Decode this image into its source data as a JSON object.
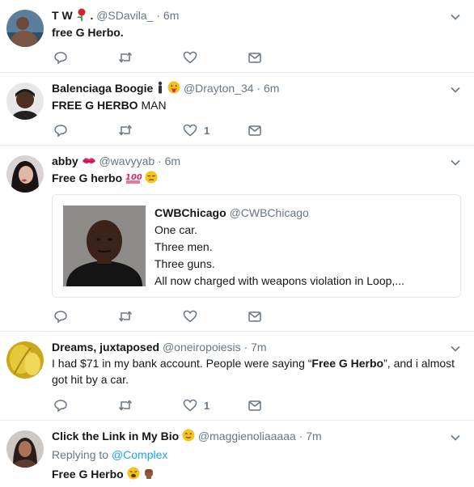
{
  "tweets": [
    {
      "name": "T W",
      "name_suffix": ".",
      "handle": "@SDavila_",
      "time": "6m",
      "text_bold": "free G Herbo.",
      "text_rest": "",
      "like_count": ""
    },
    {
      "name": "Balenciaga Boogie",
      "handle": "@Drayton_34",
      "time": "6m",
      "text_bold": "FREE G HERBO",
      "text_rest": " MAN",
      "like_count": "1"
    },
    {
      "name": "abby",
      "handle": "@wavyyab",
      "time": "6m",
      "text_bold": "Free G herbo",
      "text_rest": "",
      "like_count": "",
      "quoted": {
        "name": "CWBChicago",
        "handle": "@CWBChicago",
        "lines": [
          "One car.",
          "Three men.",
          "Three guns.",
          "All now charged with weapons violation in Loop,..."
        ]
      }
    },
    {
      "name": "Dreams, juxtaposed",
      "handle": "@oneiropoiesis",
      "time": "7m",
      "text_line1_a": "I had $71 in my bank account. People were saying “",
      "text_line1_b": "Free G Herbo",
      "text_line1_c": "”, and i almost",
      "text_line2": "got hit by a car.",
      "like_count": "1"
    },
    {
      "name": "Click the Link in My Bio",
      "handle": "@maggienoliaaaaa",
      "time": "7m",
      "replying_label": "Replying to",
      "replying_handle": "@Complex",
      "text_bold": "Free G Herbo"
    }
  ],
  "separator": "·",
  "colors": {
    "accent": "#1da1f2",
    "muted": "#657786",
    "text": "#14171a",
    "divider": "#e6ecf0"
  }
}
